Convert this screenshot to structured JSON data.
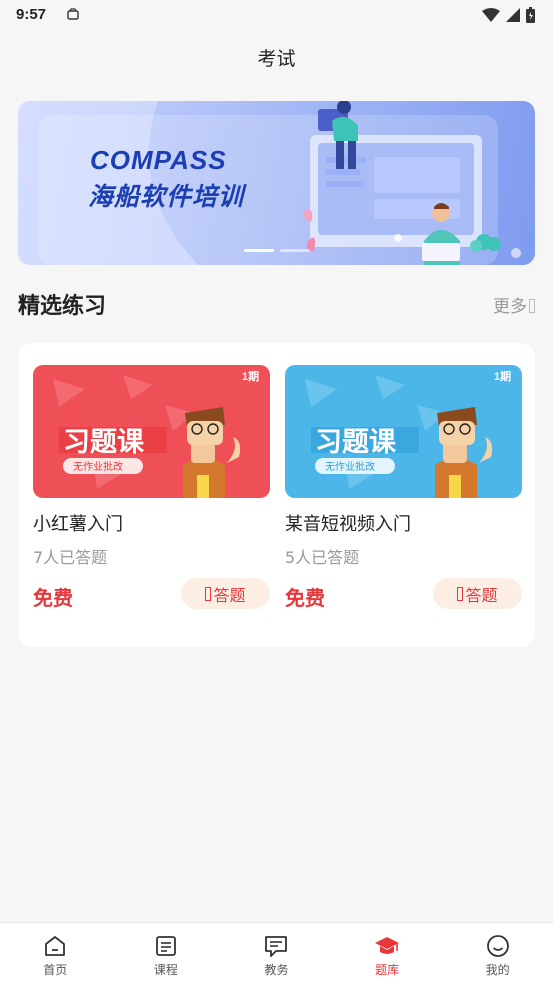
{
  "status_bar": {
    "time": "9:57"
  },
  "header": {
    "title": "考试"
  },
  "banner": {
    "line1": "COMPASS",
    "line2": "海船软件培训",
    "page_count": 2,
    "active_page": 1
  },
  "section": {
    "title": "精选练习",
    "more_label": "更多"
  },
  "courses": [
    {
      "name": "小红薯入门",
      "count": "7人已答题",
      "price": "免费",
      "action": "答题",
      "thumb_title": "习题课",
      "thumb_subtitle": "无作业批改",
      "thumb_badge": "1期",
      "thumb_color": "#ef4f57"
    },
    {
      "name": "某音短视频入门",
      "count": "5人已答题",
      "price": "免费",
      "action": "答题",
      "thumb_title": "习题课",
      "thumb_subtitle": "无作业批改",
      "thumb_badge": "1期",
      "thumb_color": "#4db6e8"
    }
  ],
  "tabs": [
    {
      "label": "首页",
      "icon": "home-icon",
      "active": false
    },
    {
      "label": "课程",
      "icon": "course-icon",
      "active": false
    },
    {
      "label": "教务",
      "icon": "teaching-icon",
      "active": false
    },
    {
      "label": "题库",
      "icon": "graduation-cap-icon",
      "active": true
    },
    {
      "label": "我的",
      "icon": "smile-icon",
      "active": false
    }
  ],
  "colors": {
    "accent": "#e8363a",
    "banner_text": "#1b3fb3",
    "background": "#f6f6f6"
  }
}
